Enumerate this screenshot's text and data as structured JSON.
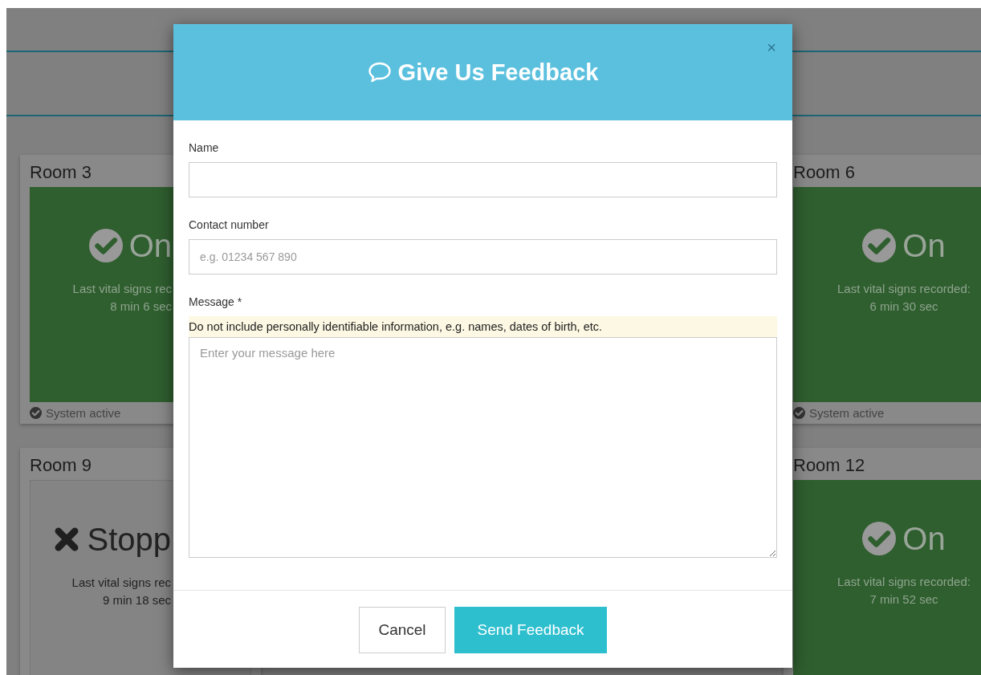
{
  "rooms": [
    {
      "name": "Room 3",
      "kind": "on",
      "status_text": "On",
      "detail": "Last vital signs rec",
      "elapsed": "8 min 6 sec",
      "footer": "System active"
    },
    {
      "name": "Room 6",
      "kind": "on",
      "status_text": "On",
      "detail": "Last vital signs recorded:",
      "elapsed": "6 min 30 sec",
      "footer": "System active"
    },
    {
      "name": "Room 9",
      "kind": "stopped",
      "status_text": "Stopp",
      "detail": "Last vital signs rec",
      "elapsed": "9 min 18 sec"
    },
    {
      "name": "Room 12",
      "kind": "on",
      "status_text": "On",
      "detail": "Last vital signs recorded:",
      "elapsed": "7 min 52 sec"
    }
  ],
  "dialog": {
    "title": "Give Us Feedback",
    "close": "×",
    "fields": [
      {
        "kind": "input",
        "label": "Name"
      },
      {
        "kind": "input",
        "label": "Contact number",
        "placeholder": "e.g. 01234 567 890"
      },
      {
        "kind": "textarea",
        "label": "Message *",
        "warning": "Do not include personally identifiable information, e.g. names, dates of birth, etc.",
        "placeholder": "Enter your message here"
      }
    ],
    "buttons": [
      {
        "label": "Cancel",
        "kind": "default"
      },
      {
        "label": "Send Feedback",
        "kind": "primary"
      }
    ]
  }
}
